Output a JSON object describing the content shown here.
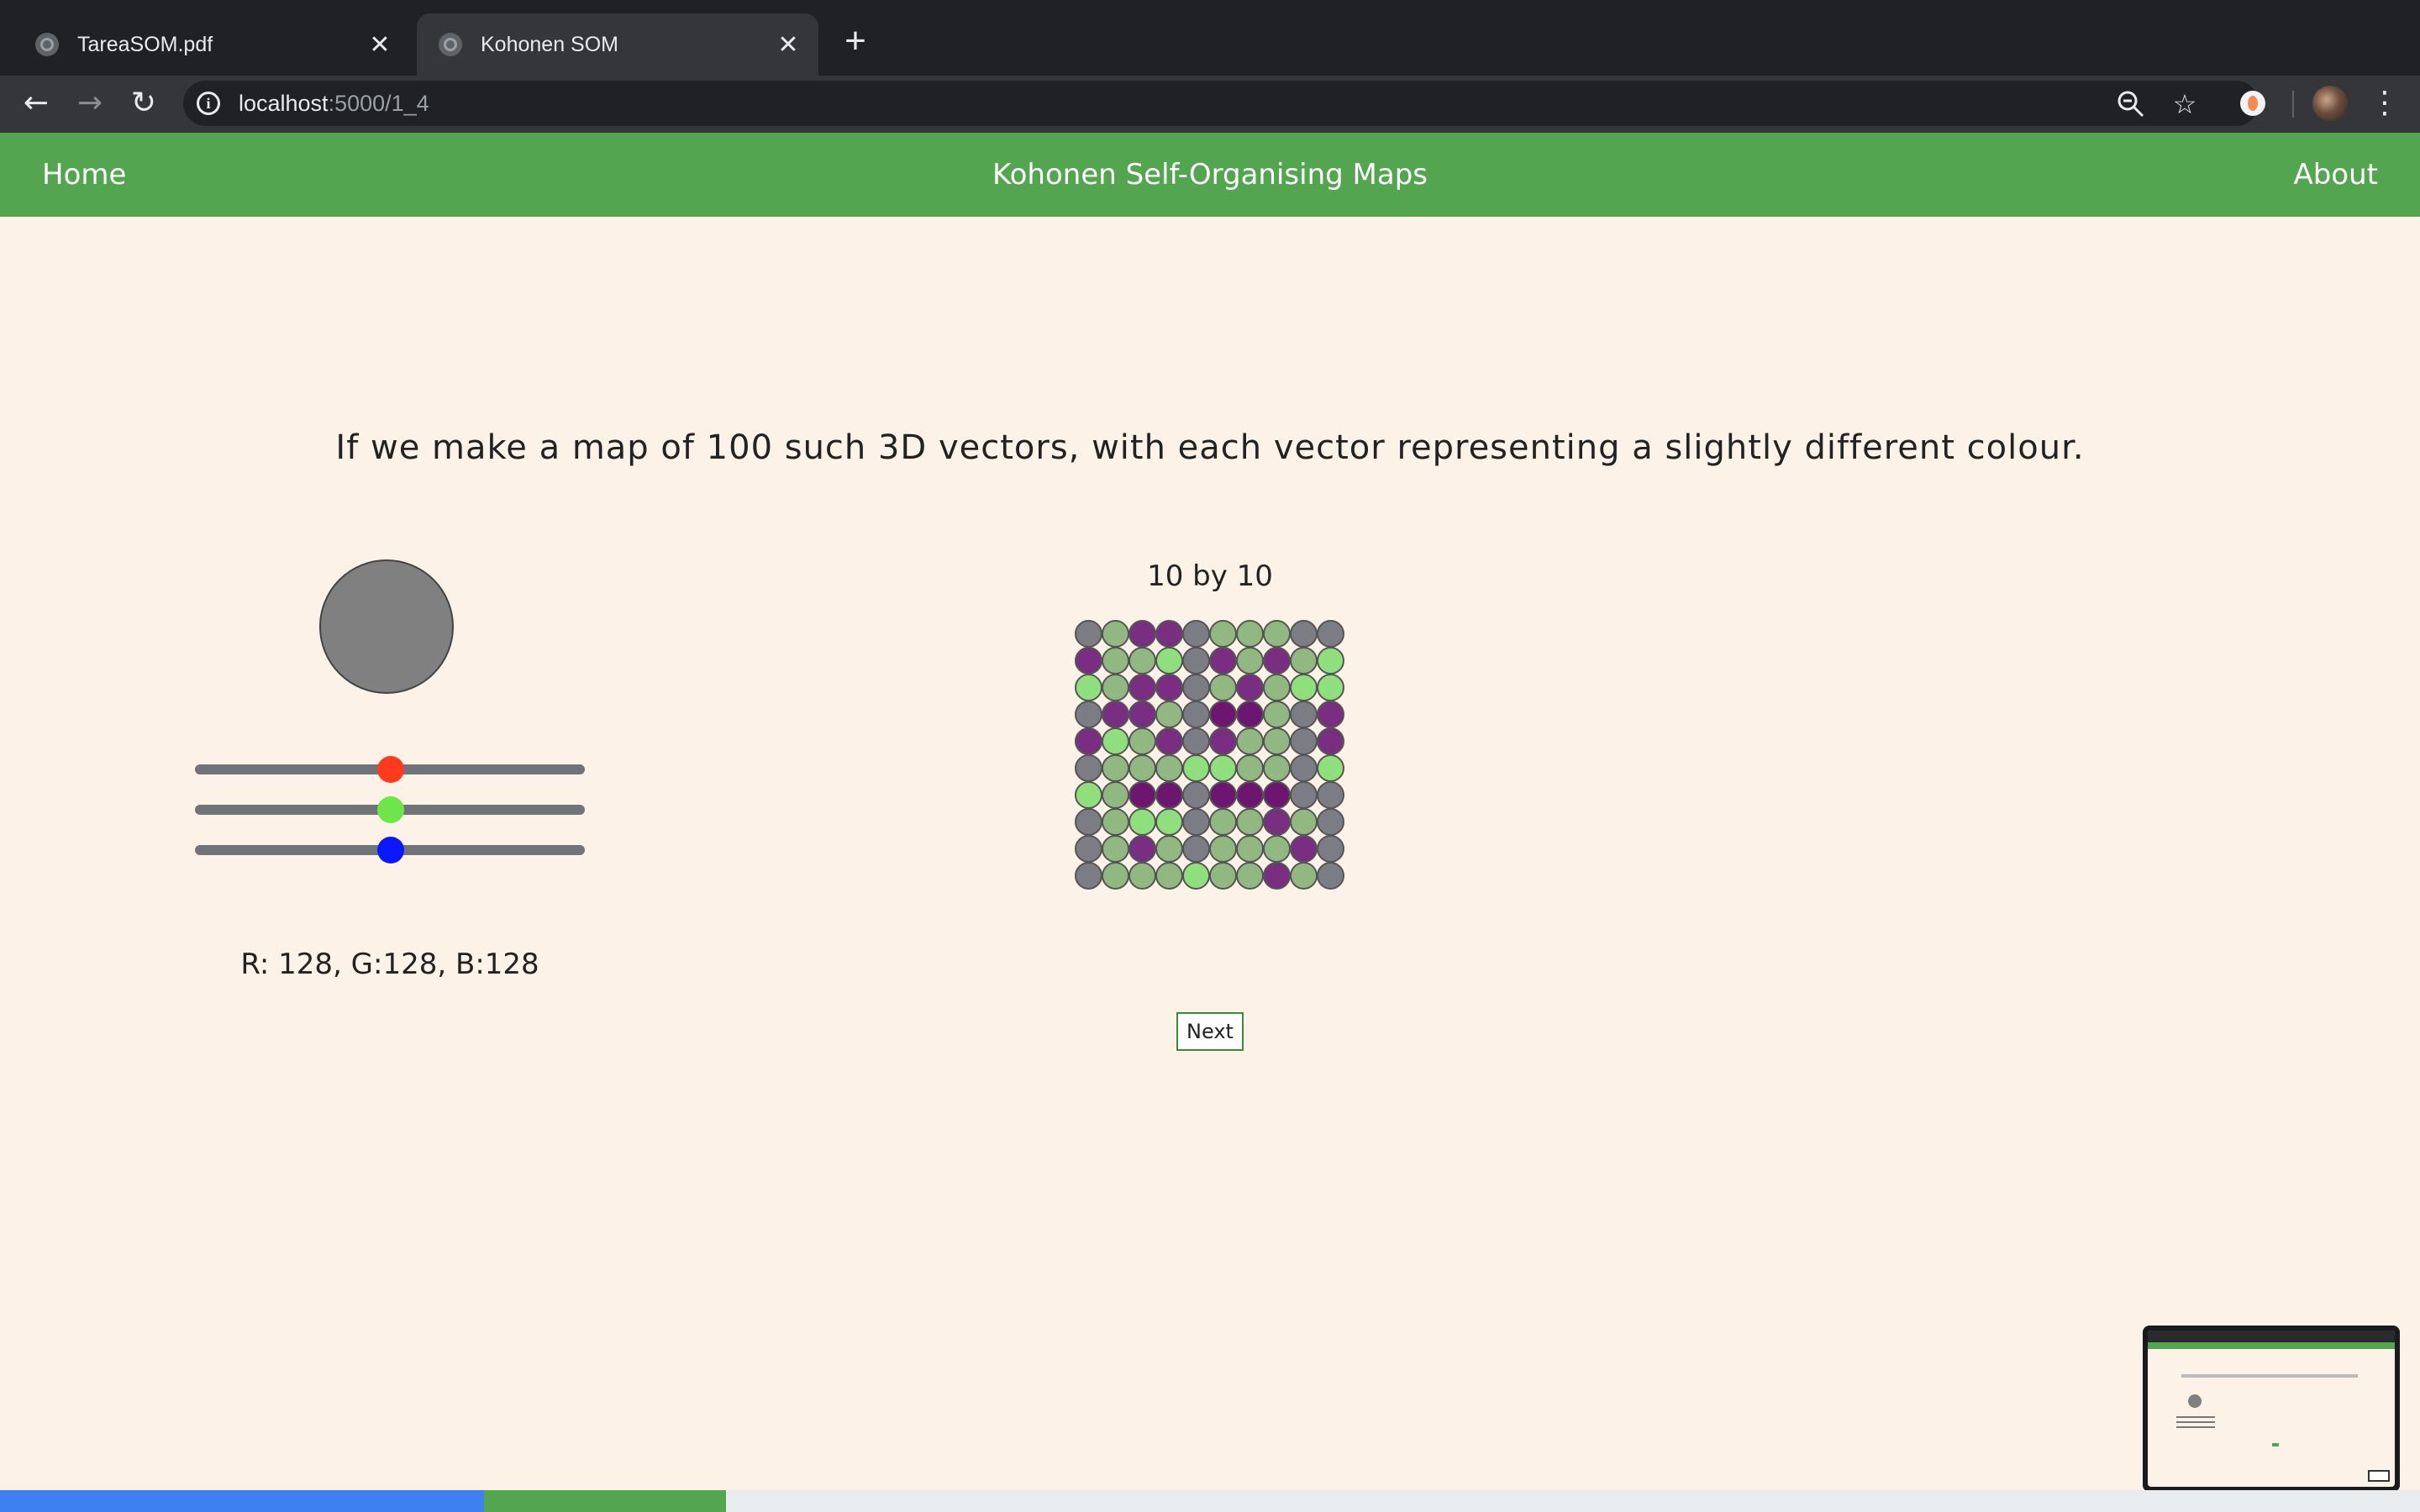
{
  "browser": {
    "tabs": [
      {
        "title": "TareaSOM.pdf",
        "active": false
      },
      {
        "title": "Kohonen SOM",
        "active": true
      }
    ],
    "url": {
      "host": "localhost",
      "path": ":5000/1_4"
    }
  },
  "navbar": {
    "home": "Home",
    "title": "Kohonen Self-Organising Maps",
    "about": "About",
    "color": "#53a550"
  },
  "content": {
    "prompt": "If we make a map of 100 such 3D vectors, with each vector representing a slightly different colour.",
    "preview_color": "#808080",
    "sliders": [
      {
        "channel": "R",
        "value": 128,
        "max": 255,
        "thumb_color": "#ff3b1f"
      },
      {
        "channel": "G",
        "value": 128,
        "max": 255,
        "thumb_color": "#6ee64a"
      },
      {
        "channel": "B",
        "value": 128,
        "max": 255,
        "thumb_color": "#0b18ff"
      }
    ],
    "rgb_readout": "R: 128, G:128, B:128",
    "grid_caption": "10 by 10",
    "grid": {
      "rows": 10,
      "cols": 10,
      "palette": {
        "g": "#7c7c84",
        "s": "#90b880",
        "l": "#8fe07c",
        "p": "#7a2e82",
        "d": "#6c1670"
      },
      "cells": [
        "gsppgsssgg",
        "psslgpspsl",
        "lsppgspsll",
        "gppsgddsgp",
        "plspgpssgp",
        "gsssllssgl",
        "lsddgdddgg",
        "gsllgsspsg",
        "gspsgssspg",
        "gssslsspsg"
      ]
    },
    "next_button": "Next"
  },
  "progress": {
    "blue_fraction": 0.2,
    "green_fraction": 0.1
  }
}
